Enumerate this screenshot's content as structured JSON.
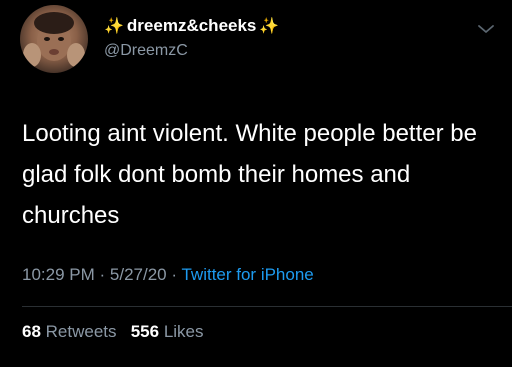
{
  "user": {
    "display_name": "dreemz&cheeks",
    "sparkle_left": "✨",
    "sparkle_right": "✨",
    "handle": "@DreemzC",
    "avatar_icon": "profile-photo"
  },
  "tweet": {
    "text": "Looting aint violent. White people better be glad folk dont bomb their homes and churches",
    "time": "10:29 PM",
    "separator": "·",
    "date": "5/27/20",
    "source": "Twitter for iPhone"
  },
  "stats": {
    "retweets_count": "68",
    "retweets_label": "Retweets",
    "likes_count": "556",
    "likes_label": "Likes"
  },
  "colors": {
    "background": "#000000",
    "primary_text": "#ffffff",
    "secondary_text": "#8b98a5",
    "link": "#1d9bf0",
    "sparkle": "#f7c948",
    "divider": "#2a2f33"
  }
}
